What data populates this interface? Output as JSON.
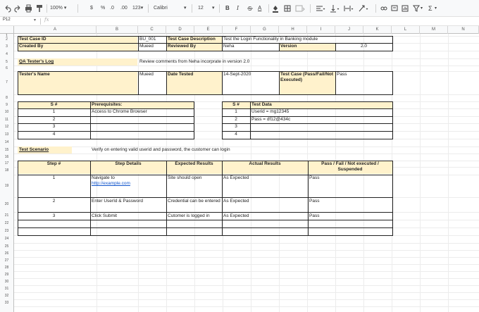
{
  "toolbar": {
    "zoom": "100%",
    "currency": "$",
    "percent": "%",
    "dec_dec": ".0",
    "dec_inc": ".00",
    "format_more": "123",
    "font": "Calibri",
    "font_size": "12",
    "bold": "B",
    "italic": "I",
    "text_color": "A"
  },
  "formula_bar": {
    "cell_ref": "P12",
    "fx": "fx",
    "value": ""
  },
  "columns": [
    "A",
    "B",
    "C",
    "D",
    "E",
    "F",
    "G",
    "H",
    "I",
    "J",
    "K",
    "L",
    "M",
    "N"
  ],
  "rows": [
    "1",
    "2",
    "3",
    "4",
    "5",
    "6",
    "7",
    "8",
    "9",
    "10",
    "11",
    "12",
    "13",
    "14",
    "15",
    "16",
    "17",
    "18",
    "19",
    "20",
    "21",
    "22",
    "23",
    "24",
    "25",
    "26",
    "27",
    "28",
    "29",
    "30",
    "31",
    "32",
    "33"
  ],
  "header": {
    "test_case_id_label": "Test Case ID",
    "test_case_id": "BU_001",
    "desc_label": "Test Case Description",
    "desc": "Test the Login Functionality in Banking module",
    "created_by_label": "Created By",
    "created_by": "Mueed",
    "reviewed_by_label": "Reviewed By",
    "reviewed_by": "Neha",
    "version_label": "Version",
    "version": "2.0"
  },
  "qa_log": {
    "label": "QA Tester's Log",
    "note": "Review comments from Neha incorprate in version 2.0"
  },
  "tester": {
    "name_label": "Tester's Name",
    "name": "Mueed",
    "date_label": "Date Tested",
    "date": "14-Sept-2020",
    "result_label": "Test Case (Pass/Fail/Not Executed)",
    "result": "Pass"
  },
  "prereq": {
    "num_label": "S #",
    "label": "Prerequisites:",
    "rows": [
      {
        "n": "1",
        "text": "Access to Chrome Browser"
      },
      {
        "n": "2",
        "text": ""
      },
      {
        "n": "3",
        "text": ""
      },
      {
        "n": "4",
        "text": ""
      }
    ]
  },
  "testdata": {
    "num_label": "S #",
    "label": "Test Data",
    "rows": [
      {
        "n": "1",
        "text": "Userid = mg12345"
      },
      {
        "n": "2",
        "text": "Pass = df12@434c"
      },
      {
        "n": "3",
        "text": ""
      },
      {
        "n": "4",
        "text": ""
      }
    ]
  },
  "scenario": {
    "label": "Test Scenario",
    "text": "Verify on entering valid userid and password, the customer can login"
  },
  "steps": {
    "headers": [
      "Step #",
      "Step Details",
      "Expected Results",
      "Actual Results",
      "Pass / Fail / Not executed / Suspended"
    ],
    "rows": [
      {
        "n": "1",
        "details": "Navigate to",
        "link": "http://example.com",
        "expected": "Site should open",
        "actual": "As Expected",
        "status": "Pass"
      },
      {
        "n": "2",
        "details": "Enter UserId & Password",
        "link": "",
        "expected": "Credential can be entered",
        "actual": "As Expected",
        "status": "Pass"
      },
      {
        "n": "3",
        "details": "Click Submit",
        "link": "",
        "expected": "Cutomer is logged in",
        "actual": "As Expected",
        "status": "Pass"
      }
    ]
  }
}
